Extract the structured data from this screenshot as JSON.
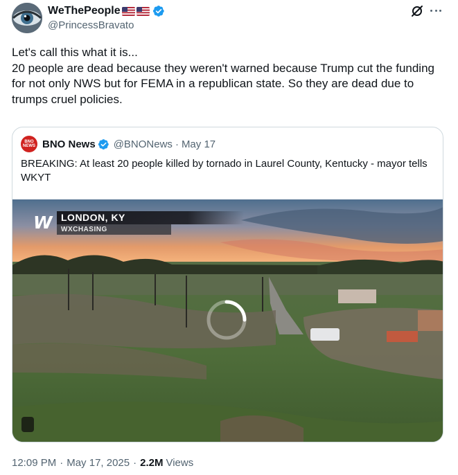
{
  "post": {
    "author": {
      "display_name": "WeThePeople",
      "flags": [
        "us-flag",
        "us-flag"
      ],
      "verified": true,
      "handle": "@PrincessBravato"
    },
    "text": "Let's call this what it is...\n20 people are dead because they weren't warned because Trump cut the funding for not only NWS but for FEMA in a republican state. So they are dead due to trumps cruel policies.",
    "icons": {
      "grok": "grok-icon",
      "more": "more-icon"
    },
    "quote": {
      "author": {
        "display_name": "BNO News",
        "verified": true,
        "handle": "@BNONews",
        "separator": "·",
        "date": "May 17",
        "avatar_text_top": "BNO",
        "avatar_text_bottom": "NEWS"
      },
      "text": "BREAKING: At least 20 people killed by tornado in Laurel County, Kentucky - mayor tells WKYT",
      "media": {
        "overlay_logo": "W",
        "overlay_location": "LONDON, KY",
        "overlay_source": "WXCHASING",
        "state": "loading"
      }
    },
    "meta": {
      "time": "12:09 PM",
      "separator": "·",
      "date": "May 17, 2025",
      "views_count": "2.2M",
      "views_label": "Views"
    },
    "colors": {
      "verified_blue": "#1d9bf0",
      "text_primary": "#0f1419",
      "text_secondary": "#536471",
      "border": "#cfd9de",
      "bno_red": "#d0221f"
    }
  }
}
